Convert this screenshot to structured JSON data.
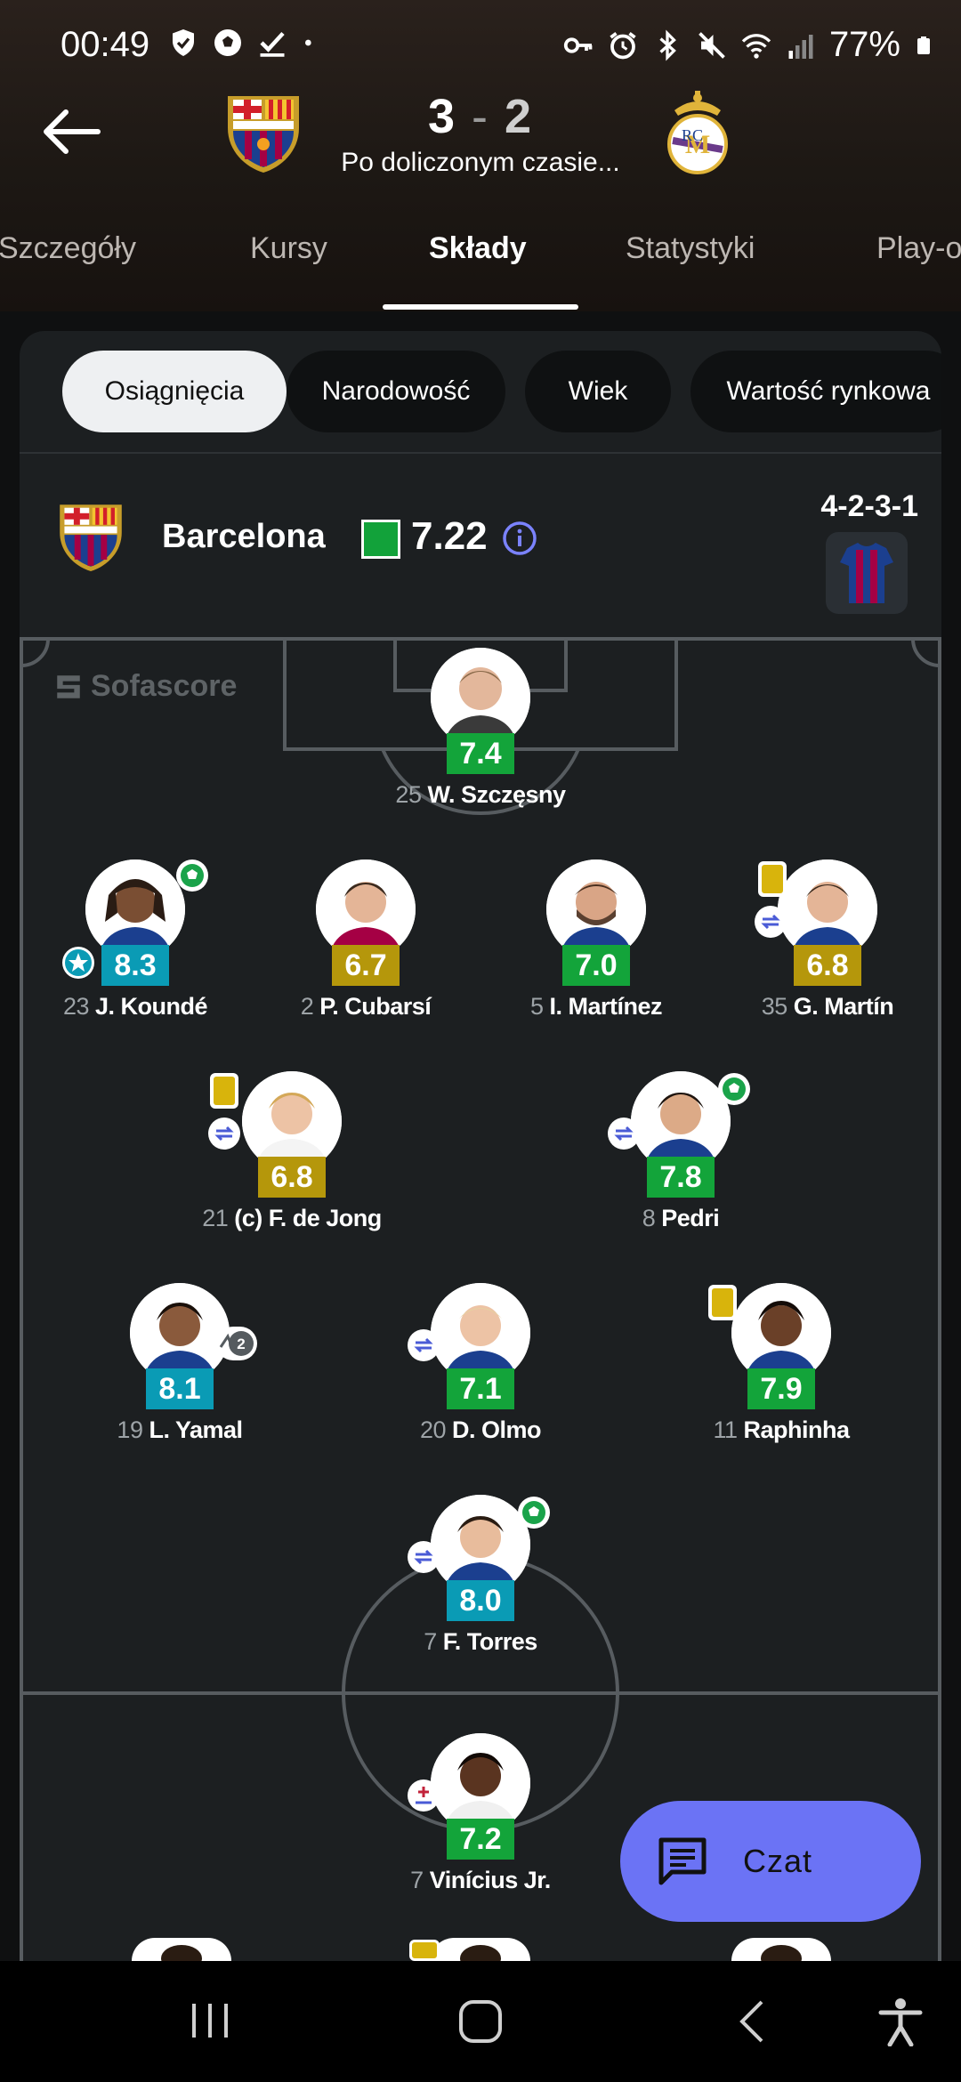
{
  "status_bar": {
    "time": "00:49",
    "battery": "77%",
    "left_icons": [
      "shield-icon",
      "football-icon",
      "check-icon",
      "dot-icon"
    ],
    "right_icons": [
      "key-icon",
      "alarm-icon",
      "bluetooth-icon",
      "mute-icon",
      "wifi-icon",
      "signal-icon",
      "battery-icon"
    ]
  },
  "match": {
    "home_score": "3",
    "separator": "-",
    "away_score": "2",
    "status": "Po doliczonym czasie..."
  },
  "tabs": [
    {
      "label": "Szczegóły"
    },
    {
      "label": "Kursy"
    },
    {
      "label": "Składy"
    },
    {
      "label": "Statystyki"
    },
    {
      "label": "Play-o"
    }
  ],
  "active_tab": "Składy",
  "filter_chips": [
    {
      "label": "Osiągnięcia"
    },
    {
      "label": "Narodowość"
    },
    {
      "label": "Wiek"
    },
    {
      "label": "Wartość rynkowa"
    }
  ],
  "team": {
    "name": "Barcelona",
    "rating": "7.22",
    "formation": "4-2-3-1"
  },
  "watermark": "Sofascore",
  "players": [
    {
      "num": "25",
      "name": "W. Szczęsny",
      "rating": "7.4",
      "rating_color": "green"
    },
    {
      "num": "23",
      "name": "J. Koundé",
      "rating": "8.3",
      "rating_color": "teal"
    },
    {
      "num": "2",
      "name": "P. Cubarsí",
      "rating": "6.7",
      "rating_color": "gold"
    },
    {
      "num": "5",
      "name": "I. Martínez",
      "rating": "7.0",
      "rating_color": "green"
    },
    {
      "num": "35",
      "name": "G. Martín",
      "rating": "6.8",
      "rating_color": "gold"
    },
    {
      "num": "21",
      "name": "(c) F. de Jong",
      "rating": "6.8",
      "rating_color": "gold"
    },
    {
      "num": "8",
      "name": "Pedri",
      "rating": "7.8",
      "rating_color": "green"
    },
    {
      "num": "19",
      "name": "L. Yamal",
      "rating": "8.1",
      "rating_color": "teal",
      "assists": "2"
    },
    {
      "num": "20",
      "name": "D. Olmo",
      "rating": "7.1",
      "rating_color": "green"
    },
    {
      "num": "11",
      "name": "Raphinha",
      "rating": "7.9",
      "rating_color": "green"
    },
    {
      "num": "7",
      "name": "F. Torres",
      "rating": "8.0",
      "rating_color": "teal"
    },
    {
      "num": "7",
      "name": "Vinícius Jr.",
      "rating": "7.2",
      "rating_color": "green"
    }
  ],
  "chat": {
    "label": "Czat"
  },
  "colors": {
    "rating_green": "#13a43a",
    "rating_teal": "#0a9bb5",
    "rating_gold": "#b5970b",
    "accent": "#6b73f5",
    "barca_blue": "#1b3f8f",
    "barca_red": "#a50044"
  },
  "nav": [
    "recents-icon",
    "home-icon",
    "back-icon",
    "accessibility-icon"
  ]
}
